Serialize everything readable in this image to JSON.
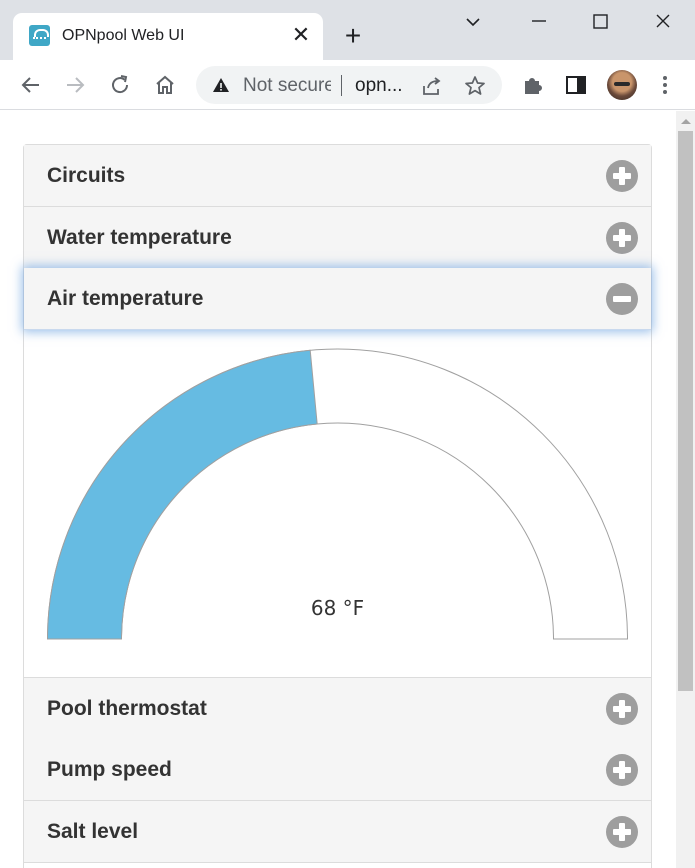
{
  "browser": {
    "tab_title": "OPNpool Web UI",
    "security_label": "Not secure",
    "url": "opn..."
  },
  "accordion": {
    "sections": [
      {
        "title": "Circuits",
        "expanded": false
      },
      {
        "title": "Water temperature",
        "expanded": false
      },
      {
        "title": "Air temperature",
        "expanded": true
      },
      {
        "title": "Pool thermostat",
        "expanded": false
      },
      {
        "title": "Pump speed",
        "expanded": false
      },
      {
        "title": "Salt level",
        "expanded": false
      }
    ]
  },
  "gauge": {
    "label": "68 °F",
    "fill_fraction": 0.47,
    "fill_color": "#66bbe2",
    "empty_color": "#ffffff",
    "outline_color": "#a0a0a0"
  }
}
